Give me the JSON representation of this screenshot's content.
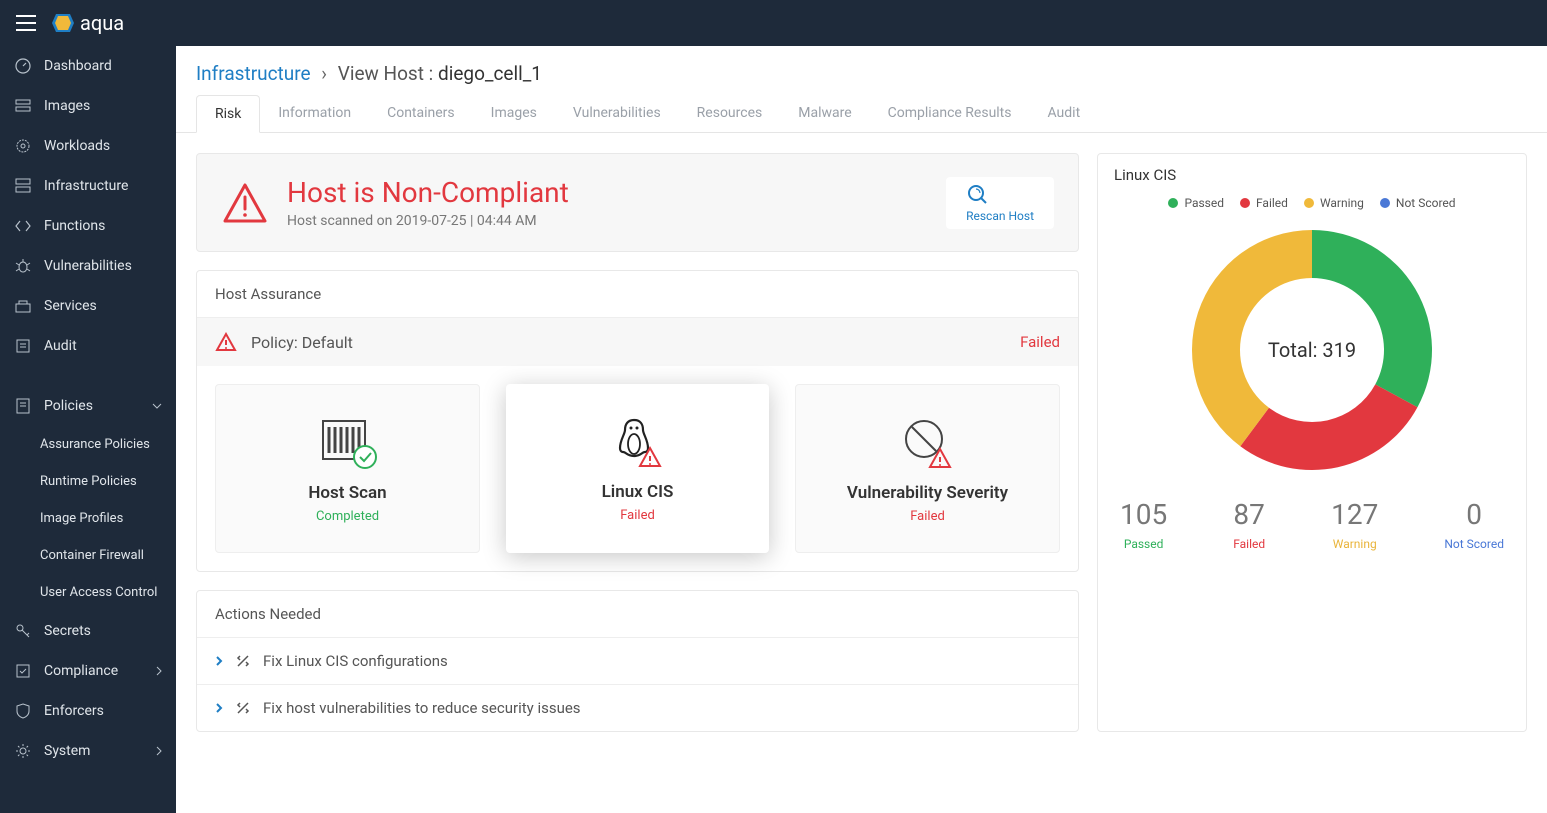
{
  "brand": {
    "name": "aqua"
  },
  "sidebar": {
    "items": [
      {
        "label": "Dashboard"
      },
      {
        "label": "Images"
      },
      {
        "label": "Workloads"
      },
      {
        "label": "Infrastructure"
      },
      {
        "label": "Functions"
      },
      {
        "label": "Vulnerabilities"
      },
      {
        "label": "Services"
      },
      {
        "label": "Audit"
      }
    ],
    "policies": {
      "label": "Policies",
      "subs": [
        {
          "label": "Assurance Policies"
        },
        {
          "label": "Runtime Policies"
        },
        {
          "label": "Image Profiles"
        },
        {
          "label": "Container Firewall"
        },
        {
          "label": "User Access Control"
        }
      ]
    },
    "secrets": {
      "label": "Secrets"
    },
    "compliance": {
      "label": "Compliance"
    },
    "enforcers": {
      "label": "Enforcers"
    },
    "system": {
      "label": "System"
    }
  },
  "breadcrumb": {
    "root": "Infrastructure",
    "page": "View Host",
    "host": "diego_cell_1"
  },
  "tabs": [
    {
      "label": "Risk",
      "active": true
    },
    {
      "label": "Information"
    },
    {
      "label": "Containers"
    },
    {
      "label": "Images"
    },
    {
      "label": "Vulnerabilities"
    },
    {
      "label": "Resources"
    },
    {
      "label": "Malware"
    },
    {
      "label": "Compliance Results"
    },
    {
      "label": "Audit"
    }
  ],
  "noncompliant": {
    "title": "Host is Non-Compliant",
    "subtitle": "Host scanned on 2019-07-25 | 04:44 AM",
    "rescan": "Rescan Host"
  },
  "host_assurance": {
    "title": "Host Assurance",
    "policy_label": "Policy: Default",
    "policy_status": "Failed",
    "cards": [
      {
        "title": "Host Scan",
        "status": "Completed",
        "status_class": "st-completed"
      },
      {
        "title": "Linux CIS",
        "status": "Failed",
        "status_class": "st-failed"
      },
      {
        "title": "Vulnerability Severity",
        "status": "Failed",
        "status_class": "st-failed"
      }
    ]
  },
  "actions_needed": {
    "title": "Actions Needed",
    "items": [
      {
        "label": "Fix Linux CIS configurations"
      },
      {
        "label": "Fix host vulnerabilities to reduce security issues"
      }
    ]
  },
  "side": {
    "title": "Linux CIS",
    "legend": [
      {
        "label": "Passed",
        "color": "#2fb05a"
      },
      {
        "label": "Failed",
        "color": "#e2383f"
      },
      {
        "label": "Warning",
        "color": "#f0b93a"
      },
      {
        "label": "Not Scored",
        "color": "#4a78d6"
      }
    ],
    "total_label": "Total: 319",
    "stats": [
      {
        "num": "105",
        "label": "Passed",
        "class": "lbl-passed"
      },
      {
        "num": "87",
        "label": "Failed",
        "class": "lbl-failed"
      },
      {
        "num": "127",
        "label": "Warning",
        "class": "lbl-warning"
      },
      {
        "num": "0",
        "label": "Not Scored",
        "class": "lbl-notscored"
      }
    ]
  },
  "chart_data": {
    "type": "pie",
    "title": "Linux CIS",
    "series": [
      {
        "name": "Passed",
        "value": 105,
        "color": "#2fb05a"
      },
      {
        "name": "Failed",
        "value": 87,
        "color": "#e2383f"
      },
      {
        "name": "Warning",
        "value": 127,
        "color": "#f0b93a"
      },
      {
        "name": "Not Scored",
        "value": 0,
        "color": "#4a78d6"
      }
    ],
    "total": 319
  }
}
